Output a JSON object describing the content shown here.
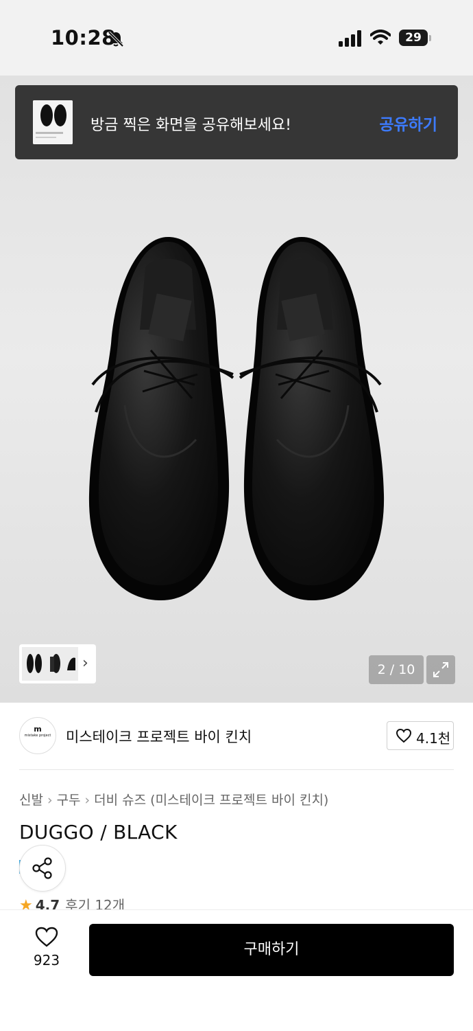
{
  "status_bar": {
    "time": "10:28",
    "battery": "29"
  },
  "toast": {
    "message": "방금 찍은 화면을 공유해보세요!",
    "action_label": "공유하기"
  },
  "gallery": {
    "counter": "2 / 10"
  },
  "brand": {
    "name": "미스테이크 프로젝트 바이 킨치",
    "logo_text": "mistake project",
    "logo_mark": "m",
    "likes": "4.1천"
  },
  "breadcrumb": [
    "신발",
    "구두",
    "더비 슈즈 (미스테이크 프로젝트 바이 킨치)"
  ],
  "product": {
    "title": "DUGGO / BLACK",
    "rating": "4.7",
    "reviews": "후기 12개"
  },
  "bottom_bar": {
    "wish_count": "923",
    "buy_label": "구매하기"
  },
  "colors": {
    "accent": "#3d7bff",
    "toast_bg": "#363636",
    "buy_bg": "#000000",
    "star": "#f5a623"
  },
  "icons": [
    "bell-muted-icon",
    "signal-icon",
    "wifi-icon",
    "battery-icon",
    "chevron-right-icon",
    "expand-icon",
    "heart-icon",
    "share-icon",
    "star-icon"
  ]
}
